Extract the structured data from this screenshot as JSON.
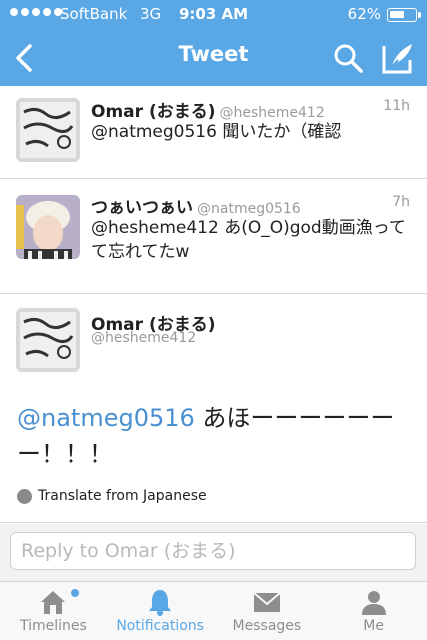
{
  "status_bar": {
    "carrier": "SoftBank",
    "network": "3G",
    "time": "9:03 AM",
    "battery_text": "62%",
    "battery_level": 0.62
  },
  "nav": {
    "title": "Tweet",
    "back_icon": "chevron-left-icon",
    "search_icon": "search-icon",
    "compose_icon": "compose-icon"
  },
  "tweets": [
    {
      "name": "Omar (おまる)",
      "handle": "@hesheme412",
      "time": "11h",
      "text": "@natmeg0516 聞いたか（確認"
    },
    {
      "name": "つぁいつぁい",
      "handle": "@natmeg0516",
      "time": "7h",
      "text": "@hesheme412 あ(O_O)god動画漁ってて忘れてたw"
    }
  ],
  "detail": {
    "name": "Omar (おまる)",
    "handle": "@hesheme412",
    "mention": "@natmeg0516",
    "text": " あほーーーーーーー！！！",
    "translate": "Translate from Japanese"
  },
  "reply": {
    "placeholder": "Reply to Omar (おまる)"
  },
  "tabs": [
    {
      "label": "Timelines"
    },
    {
      "label": "Notifications"
    },
    {
      "label": "Messages"
    },
    {
      "label": "Me"
    }
  ],
  "colors": {
    "brand": "#5aa7e6",
    "link": "#4a90d1"
  }
}
